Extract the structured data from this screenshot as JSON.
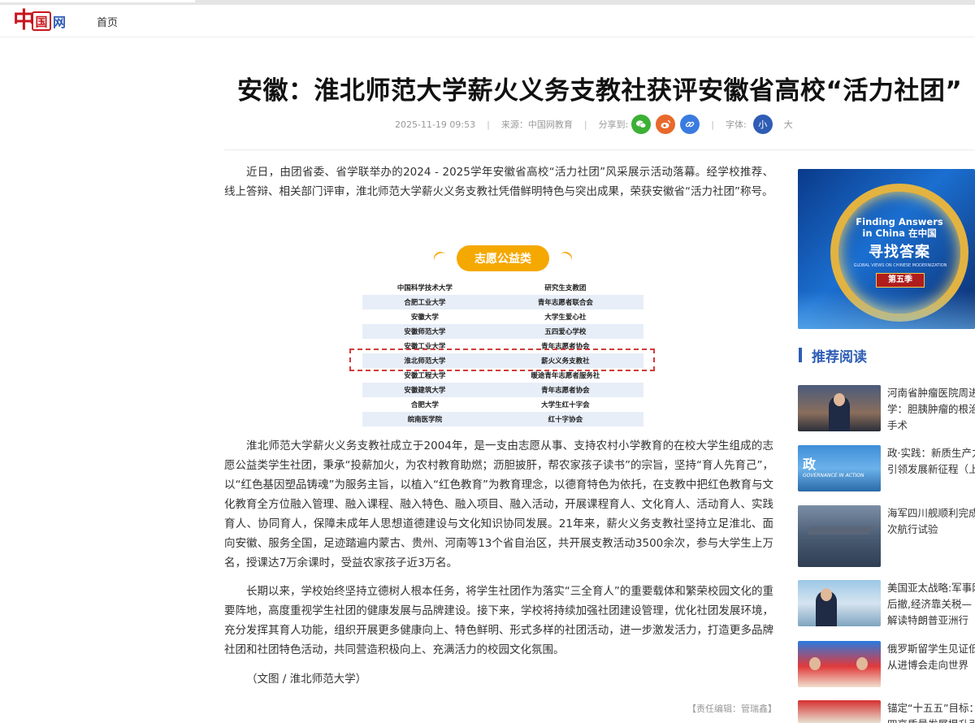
{
  "header": {
    "logo": {
      "zhong": "中",
      "guo": "国",
      "wang": "网"
    },
    "nav_home": "首页"
  },
  "article": {
    "title": "安徽：淮北师范大学薪火义务支教社获评安徽省高校“活力社团”",
    "meta": {
      "datetime": "2025-11-19 09:53",
      "source": "来源：中国网教育",
      "share_label": "分享到:",
      "font_label": "字体:",
      "font_small": "小",
      "font_large": "大"
    },
    "paragraphs": [
      "近日，由团省委、省学联举办的2024 - 2025学年安徽省高校“活力社团”风采展示活动落幕。经学校推荐、线上答辩、相关部门评审，淮北师范大学薪火义务支教社凭借鲜明特色与突出成果，荣获安徽省“活力社团”称号。",
      "淮北师范大学薪火义务支教社成立于2004年，是一支由志愿从事、支持农村小学教育的在校大学生组成的志愿公益类学生社团，秉承“投薪加火，为农村教育助燃；沥胆披肝，帮农家孩子读书”的宗旨，坚持“育人先育己”，以“红色基因塑品铸魂”为服务主旨，以植入“红色教育”为教育理念，以德育特色为依托，在支教中把红色教育与文化教育全方位融入管理、融入课程、融入特色、融入项目、融入活动，开展课程育人、文化育人、活动育人、实践育人、协同育人，保障未成年人思想道德建设与文化知识协同发展。21年来，薪火义务支教社坚持立足淮北、面向安徽、服务全国，足迹踏遍内蒙古、贵州、河南等13个省自治区，共开展支教活动3500余次，参与大学生上万名，授课达7万余课时，受益农家孩子近3万名。",
      "长期以来，学校始终坚持立德树人根本任务，将学生社团作为落实“三全育人”的重要载体和繁荣校园文化的重要阵地，高度重视学生社团的健康发展与品牌建设。接下来，学校将持续加强社团建设管理，优化社团发展环境，充分发挥其育人功能，组织开展更多健康向上、特色鲜明、形式多样的社团活动，进一步激发活力，打造更多品牌社团和社团特色活动，共同营造积极向上、充满活力的校园文化氛围。",
      "（文图 / 淮北师范大学）"
    ],
    "editor": "【责任编辑：管瑞鑫】",
    "figure": {
      "title": "志愿公益类",
      "rows": [
        [
          "中国科学技术大学",
          "研究生支教团"
        ],
        [
          "合肥工业大学",
          "青年志愿者联合会"
        ],
        [
          "安徽大学",
          "大学生爱心社"
        ],
        [
          "安徽师范大学",
          "五四爱心学校"
        ],
        [
          "安徽工业大学",
          "青年志愿者协会"
        ],
        [
          "淮北师范大学",
          "薪火义务支教社"
        ],
        [
          "安徽工程大学",
          "暖途青年志愿者服务社"
        ],
        [
          "安徽建筑大学",
          "青年志愿者协会"
        ],
        [
          "合肥大学",
          "大学生红十字会"
        ],
        [
          "皖南医学院",
          "红十字协会"
        ]
      ]
    }
  },
  "sidebar": {
    "banner": {
      "en": "Finding Answers in China",
      "en_extra": "在中国",
      "cn": "寻找答案",
      "sub": "GLOBAL VIEWS ON CHINESE MODERNIZATION",
      "season": "第五季"
    },
    "recommend_title": "推荐阅读",
    "items": [
      {
        "lines": [
          "河南省肿瘤医院周进",
          "学：胆胰肿瘤的根治",
          "手术"
        ]
      },
      {
        "lines": [
          "政·实践：新质生产力",
          "引领发展新征程（上"
        ]
      },
      {
        "lines": [
          "海军四川舰顺利完成",
          "次航行试验"
        ]
      },
      {
        "lines": [
          "美国亚太战略:军事网",
          "后撤,经济靠关税—",
          "解读特朗普亚洲行"
        ]
      },
      {
        "lines": [
          "俄罗斯留学生见证低",
          "从进博会走向世界"
        ]
      },
      {
        "lines": [
          "锚定“十五五”目标：",
          "四高质量发展提升引"
        ]
      }
    ],
    "thumb_labels": {
      "zheng": "政",
      "goa": "GOVERNANCE IN ACTION"
    }
  }
}
